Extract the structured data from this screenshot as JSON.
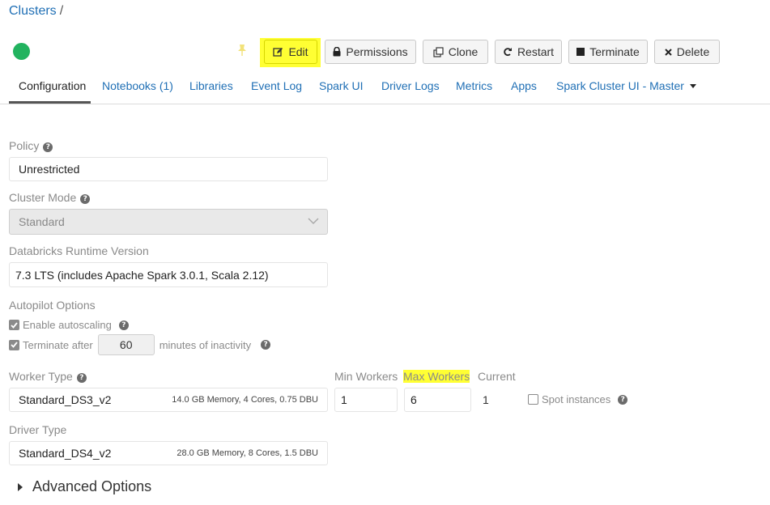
{
  "breadcrumb": {
    "root": "Clusters",
    "separator": "/"
  },
  "toolbar": {
    "edit": "Edit",
    "permissions": "Permissions",
    "clone": "Clone",
    "restart": "Restart",
    "terminate": "Terminate",
    "delete": "Delete"
  },
  "tabs": [
    "Configuration",
    "Notebooks (1)",
    "Libraries",
    "Event Log",
    "Spark UI",
    "Driver Logs",
    "Metrics",
    "Apps",
    "Spark Cluster UI - Master"
  ],
  "form": {
    "policy_label": "Policy",
    "policy_value": "Unrestricted",
    "cluster_mode_label": "Cluster Mode",
    "cluster_mode_value": "Standard",
    "runtime_label": "Databricks Runtime Version",
    "runtime_value": "7.3 LTS (includes Apache Spark 3.0.1, Scala 2.12)",
    "autopilot_label": "Autopilot Options",
    "enable_autoscaling": "Enable autoscaling",
    "terminate_after": "Terminate after",
    "terminate_minutes": "60",
    "minutes_inactivity": "minutes of inactivity",
    "worker_type_label": "Worker Type",
    "worker_type_value": "Standard_DS3_v2",
    "worker_type_spec": "14.0 GB Memory, 4 Cores, 0.75 DBU",
    "min_workers_label": "Min Workers",
    "max_workers_label": "Max Workers",
    "current_label": "Current",
    "min_workers_value": "1",
    "max_workers_value": "6",
    "current_value": "1",
    "spot_instances": "Spot instances",
    "driver_type_label": "Driver Type",
    "driver_type_value": "Standard_DS4_v2",
    "driver_type_spec": "28.0 GB Memory, 8 Cores, 1.5 DBU",
    "advanced_options": "Advanced Options"
  },
  "colors": {
    "link": "#1f6fb5",
    "highlight": "#ffff33",
    "status_running": "#22b35f"
  }
}
